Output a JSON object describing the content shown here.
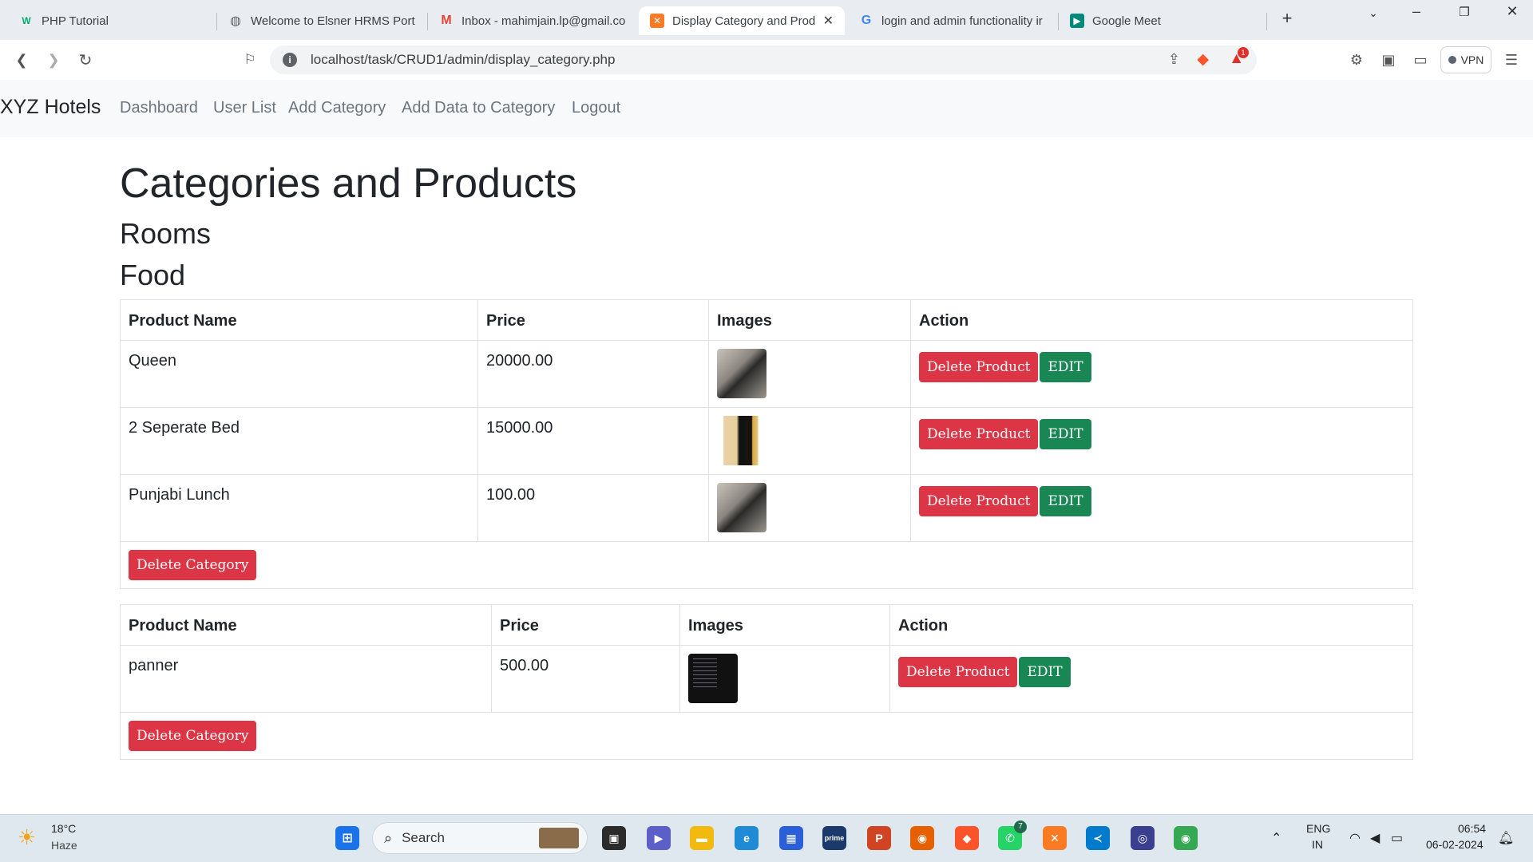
{
  "browser": {
    "tabs": [
      {
        "title": "PHP Tutorial",
        "icon": "w3schools-icon",
        "active": false
      },
      {
        "title": "Welcome to Elsner HRMS Porta",
        "icon": "globe-icon",
        "active": false
      },
      {
        "title": "Inbox - mahimjain.lp@gmail.co",
        "icon": "gmail-icon",
        "active": false
      },
      {
        "title": "Display Category and Prod",
        "icon": "xampp-icon",
        "active": true
      },
      {
        "title": "login and admin functionality ir",
        "icon": "google-icon",
        "active": false
      },
      {
        "title": "Google Meet",
        "icon": "meet-icon",
        "active": false
      }
    ],
    "url": "localhost/task/CRUD1/admin/display_category.php",
    "vpn_label": "VPN",
    "notification_count": "1"
  },
  "navbar": {
    "brand": "XYZ Hotels",
    "links": [
      "Dashboard",
      "User List",
      "Add Category",
      "Add Data to Category",
      "Logout"
    ]
  },
  "page": {
    "title": "Categories and Products",
    "categories": [
      "Rooms",
      "Food"
    ]
  },
  "table1": {
    "headers": [
      "Product Name",
      "Price",
      "Images",
      "Action"
    ],
    "rows": [
      {
        "name": "Queen",
        "price": "20000.00",
        "image": "iphone-titanium-image"
      },
      {
        "name": "2 Seperate Bed",
        "price": "15000.00",
        "image": "iphone-gold-image"
      },
      {
        "name": "Punjabi Lunch",
        "price": "100.00",
        "image": "iphone-titanium-image"
      }
    ],
    "delete_product_label": "Delete Product",
    "edit_label": "EDIT",
    "delete_category_label": "Delete Category"
  },
  "table2": {
    "headers": [
      "Product Name",
      "Price",
      "Images",
      "Action"
    ],
    "rows": [
      {
        "name": "panner",
        "price": "500.00",
        "image": "terminal-screenshot-image"
      }
    ],
    "delete_product_label": "Delete Product",
    "edit_label": "EDIT",
    "delete_category_label": "Delete Category"
  },
  "taskbar": {
    "weather_temp": "18°C",
    "weather_desc": "Haze",
    "search_placeholder": "Search",
    "lang_top": "ENG",
    "lang_bottom": "IN",
    "time": "06:54",
    "date": "06-02-2024",
    "whatsapp_badge": "7"
  },
  "colors": {
    "danger": "#dc3545",
    "success": "#198754",
    "navbar_bg": "#f8f9fa"
  }
}
